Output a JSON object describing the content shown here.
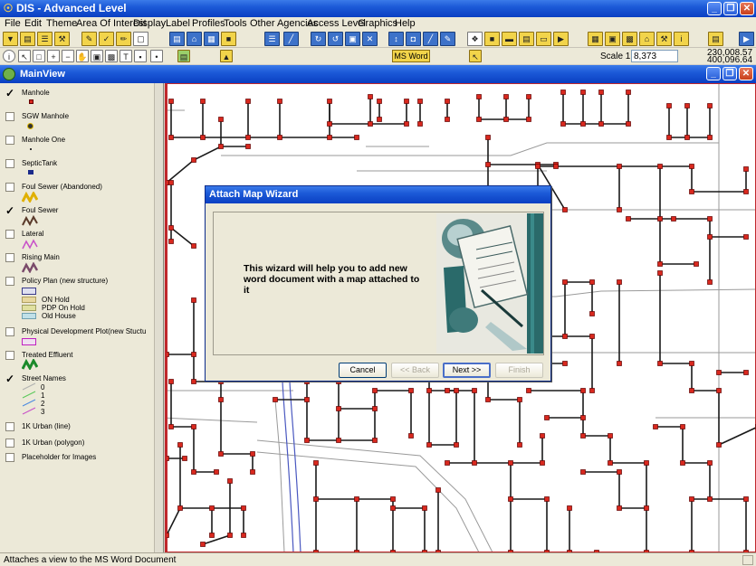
{
  "window": {
    "title": "DIS - Advanced Level"
  },
  "menu": [
    "File",
    "Edit",
    "Theme",
    "Area Of Interest",
    "Display",
    "Label",
    "Profiles",
    "Tools",
    "Other Agencies",
    "Access Level",
    "Graphics",
    "Help"
  ],
  "toolbar": {
    "ms_word_label": "MS Word",
    "scale_label": "Scale 1:",
    "scale_value": "8,373",
    "coord_x": "230,008.57",
    "coord_y": "400,096.64"
  },
  "mainview": {
    "title": "MainView"
  },
  "legend": {
    "items": [
      {
        "label": "Manhole",
        "checked": true
      },
      {
        "label": "SGW Manhole",
        "checked": false
      },
      {
        "label": "Manhole One",
        "checked": false
      },
      {
        "label": "SepticTank",
        "checked": false
      },
      {
        "label": "Foul Sewer (Abandoned)",
        "checked": false
      },
      {
        "label": "Foul Sewer",
        "checked": true
      },
      {
        "label": "Lateral",
        "checked": false
      },
      {
        "label": "Rising Main",
        "checked": false
      },
      {
        "label": "Policy Plan (new structure)",
        "checked": false
      },
      {
        "label": "Physical Development Plot(new Stuctu",
        "checked": false
      },
      {
        "label": "Treated Effluent",
        "checked": false
      },
      {
        "label": "Street Names",
        "checked": true
      },
      {
        "label": "1K Urban (line)",
        "checked": false
      },
      {
        "label": "1K Urban (polygon)",
        "checked": false
      },
      {
        "label": "Placeholder for Images",
        "checked": false
      }
    ],
    "policy_sub": [
      "ON Hold",
      "PDP On Hold",
      "Old House"
    ],
    "street_sub": [
      "0",
      "1",
      "2",
      "3"
    ]
  },
  "dialog": {
    "title": "Attach Map Wizard",
    "message": "This wizard will help you to add new word document with a map attached to it",
    "buttons": {
      "cancel": "Cancel",
      "back": "<< Back",
      "next": "Next >>",
      "finish": "Finish"
    }
  },
  "status": {
    "message": "Attaches a view to the MS Word Document"
  },
  "colors": {
    "titlebar": "#0a3fc2",
    "manhole": "#d9281e",
    "sewer": "#1a1a1a",
    "road": "#9a9a9a"
  }
}
